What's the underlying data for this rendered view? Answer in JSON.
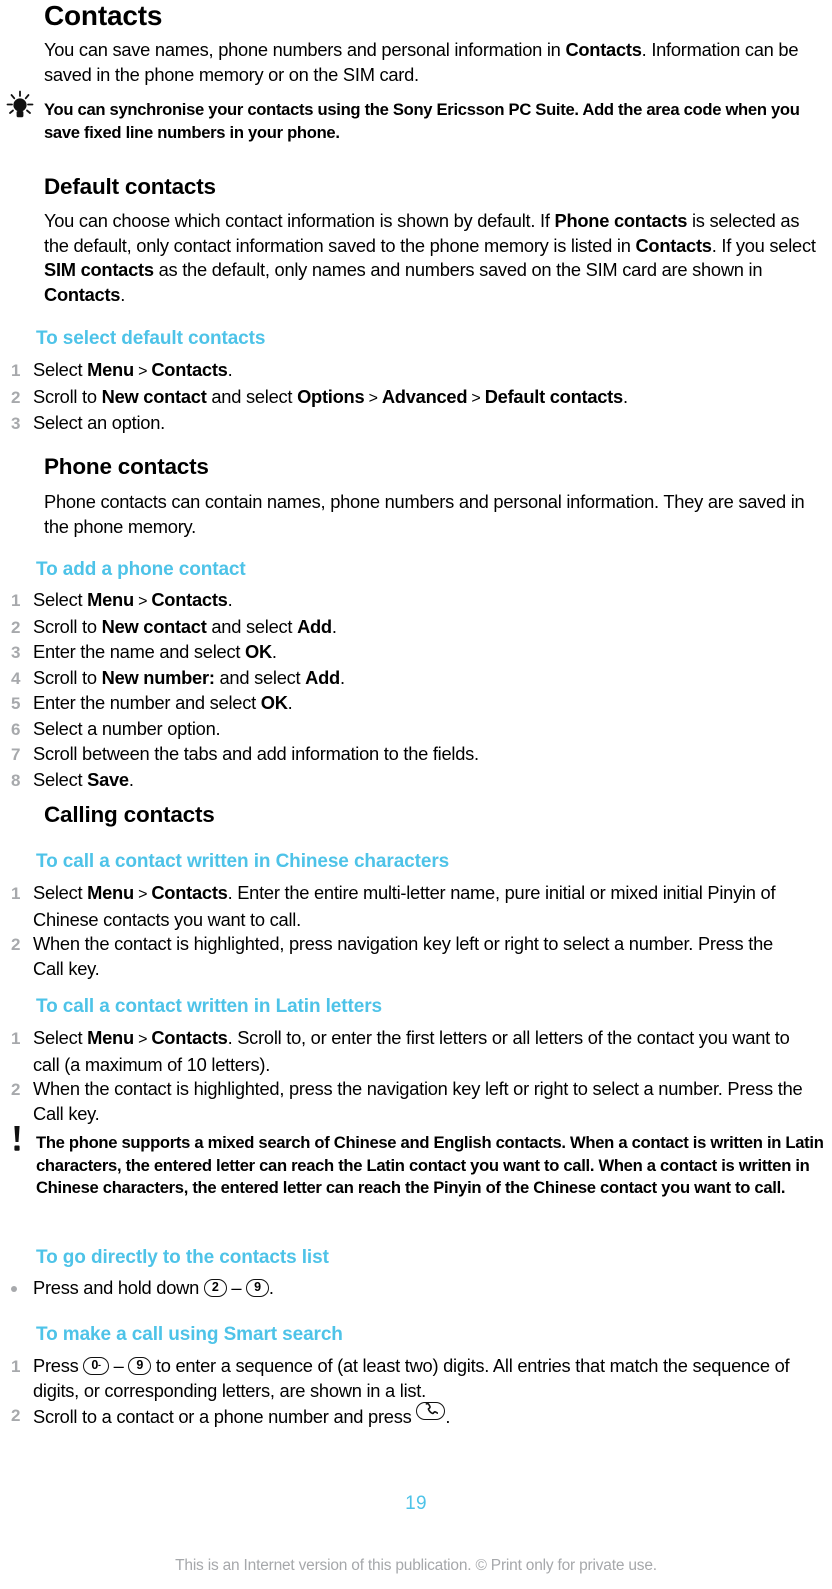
{
  "document": {
    "title": "Contacts",
    "page_number": "19",
    "copyright": "This is an Internet version of this publication. © Print only for private use.",
    "accent_color": "#4ec3e8",
    "list_marker_color": "#a7a9ac",
    "footer_color": "#a6a8ab"
  },
  "intro": {
    "p1_a": "You can save names, phone numbers and personal information in ",
    "p1_b": "Contacts",
    "p1_c": ". Information can be saved in the phone memory or on the SIM card."
  },
  "tip": {
    "icon": "lightbulb-icon",
    "text": "You can synchronise your contacts using the Sony Ericsson PC Suite. Add the area code when you save fixed line numbers in your phone."
  },
  "default_contacts": {
    "heading": "Default contacts",
    "p_a": "You can choose which contact information is shown by default. If ",
    "p_b": "Phone contacts",
    "p_c": " is selected as the default, only contact information saved to the phone memory is listed in ",
    "p_d": "Contacts",
    "p_e": ". If you select ",
    "p_f": "SIM contacts",
    "p_g": " as the default, only names and numbers saved on the SIM card are shown in ",
    "p_h": "Contacts",
    "p_i": ".",
    "task_heading": "To select default contacts",
    "steps": [
      {
        "num": "1",
        "parts": [
          {
            "t": "Select ",
            "b": false
          },
          {
            "t": "Menu",
            "b": true
          },
          {
            "t": " > ",
            "b": false,
            "gt": true
          },
          {
            "t": "Contacts",
            "b": true
          },
          {
            "t": ".",
            "b": false
          }
        ]
      },
      {
        "num": "2",
        "parts": [
          {
            "t": "Scroll to ",
            "b": false
          },
          {
            "t": "New contact",
            "b": true
          },
          {
            "t": " and select ",
            "b": false
          },
          {
            "t": "Options",
            "b": true
          },
          {
            "t": " > ",
            "b": false,
            "gt": true
          },
          {
            "t": "Advanced",
            "b": true
          },
          {
            "t": " > ",
            "b": false,
            "gt": true
          },
          {
            "t": "Default contacts",
            "b": true
          },
          {
            "t": ".",
            "b": false
          }
        ]
      },
      {
        "num": "3",
        "parts": [
          {
            "t": "Select an option.",
            "b": false
          }
        ]
      }
    ]
  },
  "phone_contacts": {
    "heading": "Phone contacts",
    "p": "Phone contacts can contain names, phone numbers and personal information. They are saved in the phone memory.",
    "task_heading": "To add a phone contact",
    "steps": [
      {
        "num": "1",
        "parts": [
          {
            "t": "Select ",
            "b": false
          },
          {
            "t": "Menu",
            "b": true
          },
          {
            "t": " > ",
            "b": false,
            "gt": true
          },
          {
            "t": "Contacts",
            "b": true
          },
          {
            "t": ".",
            "b": false
          }
        ]
      },
      {
        "num": "2",
        "parts": [
          {
            "t": "Scroll to ",
            "b": false
          },
          {
            "t": "New contact",
            "b": true
          },
          {
            "t": " and select ",
            "b": false
          },
          {
            "t": "Add",
            "b": true
          },
          {
            "t": ".",
            "b": false
          }
        ]
      },
      {
        "num": "3",
        "parts": [
          {
            "t": "Enter the name and select ",
            "b": false
          },
          {
            "t": "OK",
            "b": true
          },
          {
            "t": ".",
            "b": false
          }
        ]
      },
      {
        "num": "4",
        "parts": [
          {
            "t": "Scroll to ",
            "b": false
          },
          {
            "t": "New number:",
            "b": true
          },
          {
            "t": " and select ",
            "b": false
          },
          {
            "t": "Add",
            "b": true
          },
          {
            "t": ".",
            "b": false
          }
        ]
      },
      {
        "num": "5",
        "parts": [
          {
            "t": "Enter the number and select ",
            "b": false
          },
          {
            "t": "OK",
            "b": true
          },
          {
            "t": ".",
            "b": false
          }
        ]
      },
      {
        "num": "6",
        "parts": [
          {
            "t": "Select a number option.",
            "b": false
          }
        ]
      },
      {
        "num": "7",
        "parts": [
          {
            "t": "Scroll between the tabs and add information to the fields.",
            "b": false
          }
        ]
      },
      {
        "num": "8",
        "parts": [
          {
            "t": "Select ",
            "b": false
          },
          {
            "t": "Save",
            "b": true
          },
          {
            "t": ".",
            "b": false
          }
        ]
      }
    ]
  },
  "calling_contacts": {
    "heading": "Calling contacts",
    "chinese": {
      "task_heading": "To call a contact written in Chinese characters",
      "steps": [
        {
          "num": "1",
          "parts": [
            {
              "t": "Select ",
              "b": false
            },
            {
              "t": "Menu",
              "b": true
            },
            {
              "t": " > ",
              "b": false,
              "gt": true
            },
            {
              "t": "Contacts",
              "b": true
            },
            {
              "t": ". Enter the entire multi-letter name, pure initial or mixed initial Pinyin of Chinese contacts you want to call.",
              "b": false
            }
          ]
        },
        {
          "num": "2",
          "parts": [
            {
              "t": "When the contact is highlighted, press navigation key left or right to select a number. Press the Call key.",
              "b": false
            }
          ]
        }
      ]
    },
    "latin": {
      "task_heading": "To call a contact written in Latin letters",
      "steps": [
        {
          "num": "1",
          "parts": [
            {
              "t": "Select ",
              "b": false
            },
            {
              "t": "Menu",
              "b": true
            },
            {
              "t": " > ",
              "b": false,
              "gt": true
            },
            {
              "t": "Contacts",
              "b": true
            },
            {
              "t": ". Scroll to, or enter the first letters or all letters of the contact you want to call (a maximum of 10 letters).",
              "b": false
            }
          ]
        },
        {
          "num": "2",
          "parts": [
            {
              "t": "When the contact is highlighted, press the navigation key left or right to select a number. Press the Call key.",
              "b": false
            }
          ]
        }
      ]
    },
    "warning": {
      "icon": "exclamation-icon",
      "text": "The phone supports a mixed search of Chinese and English contacts. When a contact is written in Latin characters, the entered letter can reach the Latin contact you want to call. When a contact is written in Chinese characters, the entered letter can reach the Pinyin of the Chinese contact you want to call."
    },
    "direct_list": {
      "task_heading": "To go directly to the contacts list",
      "bullet": {
        "pre": "Press and hold down ",
        "key_from": "2",
        "dash": " – ",
        "key_to": "9",
        "post": "."
      }
    },
    "smart_search": {
      "task_heading": "To make a call using Smart search",
      "step1": {
        "num": "1",
        "pre": "Press ",
        "key_from": "0",
        "key_from_sub": "-",
        "dash": " – ",
        "key_to": "9",
        "post": " to enter a sequence of (at least two) digits. All entries that match the sequence of digits, or corresponding letters, are shown in a list."
      },
      "step2": {
        "num": "2",
        "pre": "Scroll to a contact or a phone number and press ",
        "key_icon": "call-key-icon",
        "post": "."
      }
    }
  }
}
